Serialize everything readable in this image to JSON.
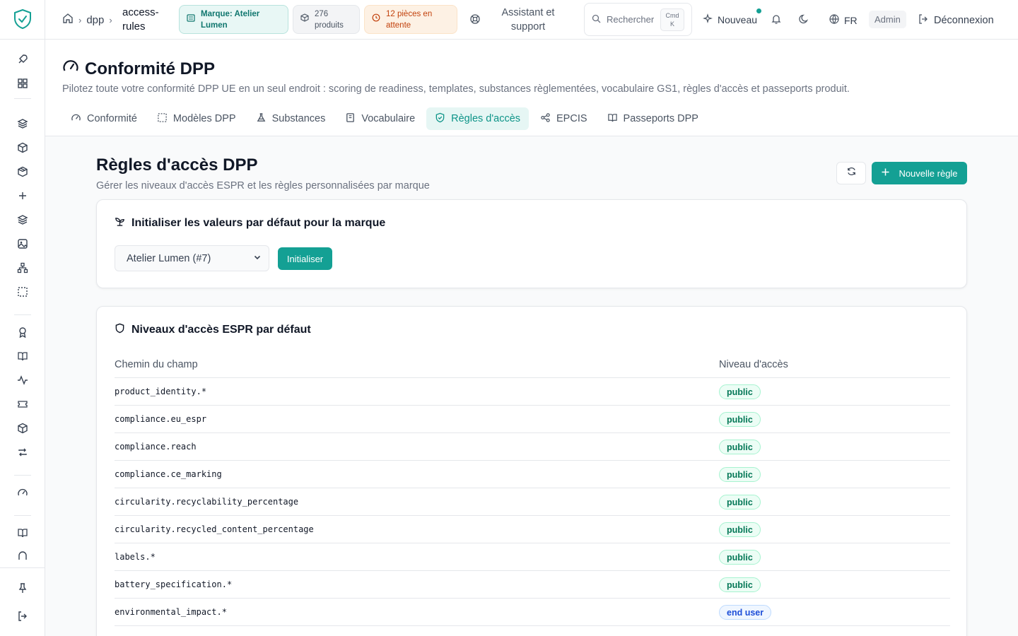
{
  "breadcrumb": {
    "home_icon": "home-icon",
    "items": [
      "dpp",
      "access-\nrules"
    ],
    "item_1": "dpp",
    "item_2_line1": "access-",
    "item_2_line2": "rules"
  },
  "topbar": {
    "brand_chip_line1": "Marque: Atelier",
    "brand_chip_line2": "Lumen",
    "products_line1": "276",
    "products_line2": "produits",
    "pending_line1": "12 pièces en",
    "pending_line2": "attente",
    "support_line1": "Assistant et",
    "support_line2": "support",
    "search_label": "Rechercher",
    "kbd_line1": "Cmd",
    "kbd_line2": "K",
    "new_label": "Nouveau",
    "lang_label": "FR",
    "admin_label": "Admin",
    "logout_label": "Déconnexion"
  },
  "header": {
    "title": "Conformité DPP",
    "description": "Pilotez toute votre conformité DPP UE en un seul endroit : scoring de readiness, templates, substances règlementées, vocabulaire GS1, règles d'accès et passeports produit.",
    "tabs": [
      {
        "label": "Conformité",
        "icon": "gauge-icon"
      },
      {
        "label": "Modèles DPP",
        "icon": "template-icon"
      },
      {
        "label": "Substances",
        "icon": "flask-icon"
      },
      {
        "label": "Vocabulaire",
        "icon": "book-icon"
      },
      {
        "label": "Règles d'accès",
        "icon": "shield-icon",
        "active": true
      },
      {
        "label": "EPCIS",
        "icon": "share-icon"
      },
      {
        "label": "Passeports DPP",
        "icon": "open-book-icon"
      }
    ]
  },
  "main": {
    "title": "Règles d'accès DPP",
    "subtitle": "Gérer les niveaux d'accès ESPR et les règles personnalisées par marque",
    "new_rule_label": "Nouvelle règle",
    "init_card": {
      "title": "Initialiser les valeurs par défaut pour la marque",
      "select_value": "Atelier Lumen (#7)",
      "button_label": "Initialiser"
    },
    "levels_card": {
      "title": "Niveaux d'accès ESPR par défaut",
      "col_path": "Chemin du champ",
      "col_level": "Niveau d'accès",
      "rows": [
        {
          "path": "product_identity.*",
          "level": "public"
        },
        {
          "path": "compliance.eu_espr",
          "level": "public"
        },
        {
          "path": "compliance.reach",
          "level": "public"
        },
        {
          "path": "compliance.ce_marking",
          "level": "public"
        },
        {
          "path": "circularity.recyclability_percentage",
          "level": "public"
        },
        {
          "path": "circularity.recycled_content_percentage",
          "level": "public"
        },
        {
          "path": "labels.*",
          "level": "public"
        },
        {
          "path": "battery_specification.*",
          "level": "public"
        },
        {
          "path": "environmental_impact.*",
          "level": "end user"
        }
      ]
    }
  },
  "colors": {
    "accent": "#14a094",
    "accent_light": "#e6f6f4",
    "public_green": "#047857",
    "enduser_blue": "#1d4ed8"
  }
}
